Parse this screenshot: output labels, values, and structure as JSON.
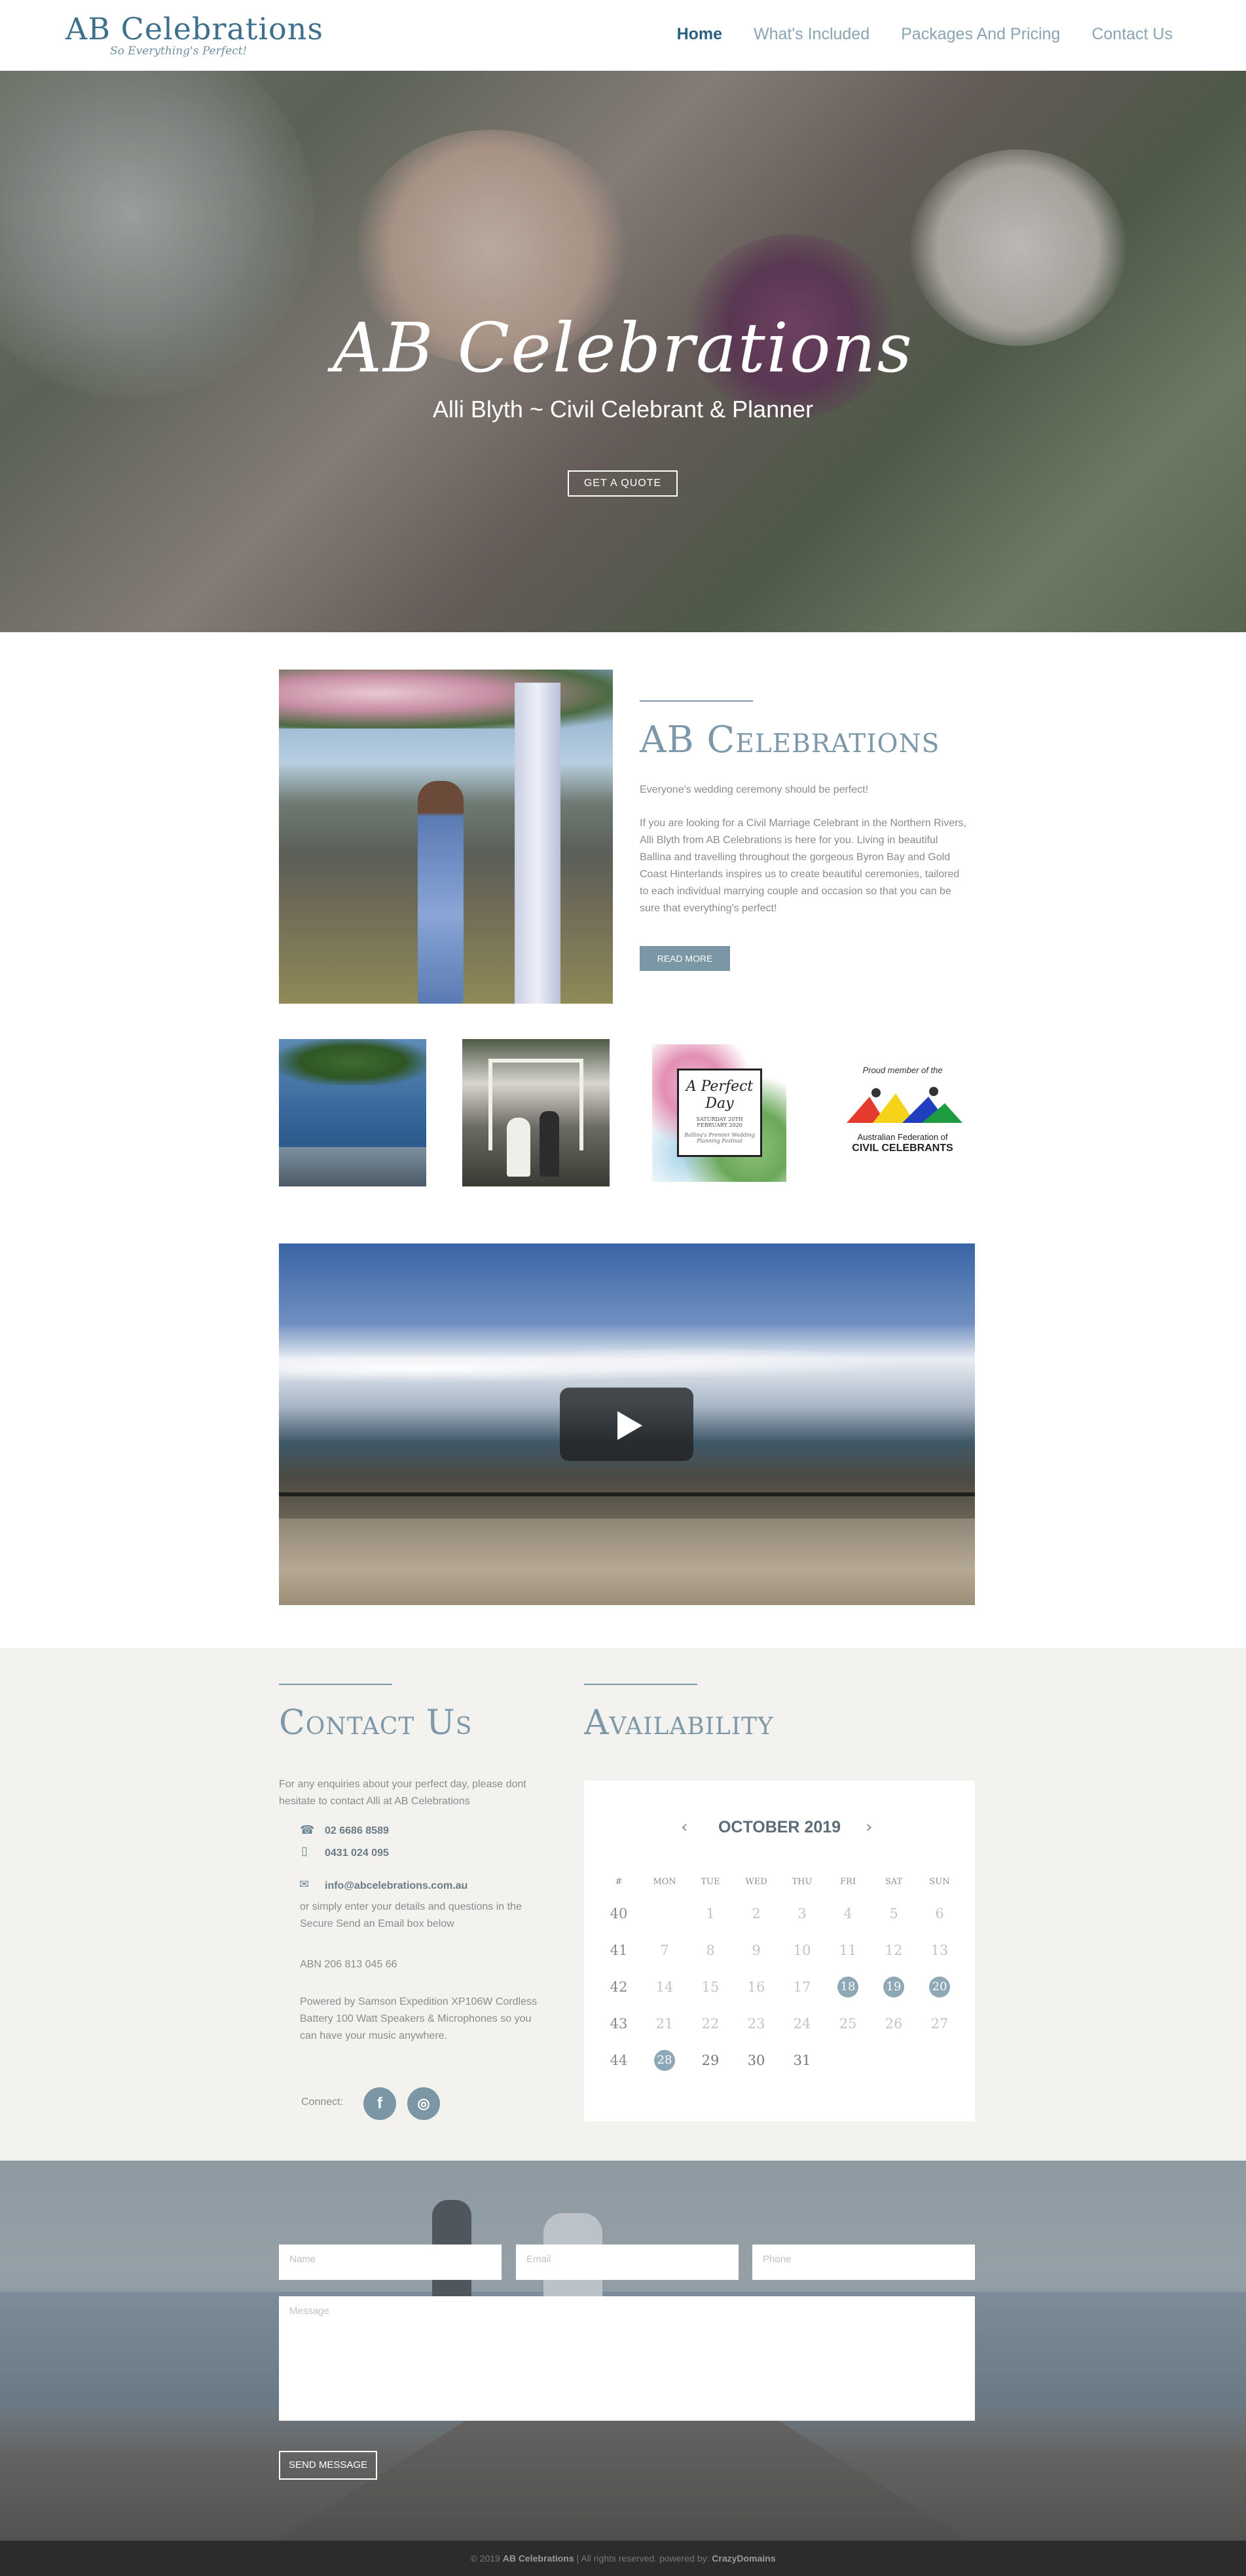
{
  "header": {
    "logo": "AB Celebrations",
    "tagline": "So Everything's Perfect!",
    "nav": [
      {
        "label": "Home",
        "active": true
      },
      {
        "label": "What's Included",
        "active": false
      },
      {
        "label": "Packages And Pricing",
        "active": false
      },
      {
        "label": "Contact Us",
        "active": false
      }
    ]
  },
  "hero": {
    "title": "AB Celebrations",
    "subtitle": "Alli Blyth ~ Civil Celebrant & Planner",
    "button": "GET A QUOTE"
  },
  "about": {
    "title": "AB Celebrations",
    "intro": "Everyone's wedding ceremony should be perfect!",
    "body": "If you are looking for a Civil Marriage Celebrant in the Northern Rivers, Alli Blyth from AB Celebrations is here for you. Living in beautiful Ballina and travelling throughout the gorgeous Byron Bay and Gold Coast Hinterlands inspires us to create beautiful ceremonies, tailored to each individual marrying couple and occasion so that you can be sure that everything's perfect!",
    "button": "READ MORE"
  },
  "badges": {
    "perfect_day": {
      "title": "A Perfect Day",
      "date": "SATURDAY 20TH FEBRUARY 2020",
      "caption": "Ballina's Premier Wedding Planning Festival"
    },
    "afcc": {
      "top": "Proud member of the",
      "line1": "Australian Federation of",
      "line2": "CIVIL CELEBRANTS"
    }
  },
  "contact": {
    "title": "Contact Us",
    "intro": "For any enquiries about your perfect day, please dont hesitate to contact Alli at AB Celebrations",
    "phone": "02 6686 8589",
    "mobile": "0431 024 095",
    "email": "info@abcelebrations.com.au",
    "email_note": "or simply enter your details and questions in the Secure Send an Email box below",
    "abn": "ABN 206 813 045 66",
    "powered": "Powered by Samson Expedition XP106W Cordless Battery 100 Watt Speakers & Microphones so you can have your music anywhere.",
    "connect_label": "Connect:",
    "social": [
      {
        "icon": "facebook-icon",
        "glyph": "f"
      },
      {
        "icon": "instagram-icon",
        "glyph": "◎"
      }
    ]
  },
  "availability": {
    "title": "Availability",
    "month": "OCTOBER 2019",
    "dow": [
      "#",
      "MON",
      "TUE",
      "WED",
      "THU",
      "FRI",
      "SAT",
      "SUN"
    ],
    "weeks": [
      {
        "week": "40",
        "days": [
          "",
          "1",
          "2",
          "3",
          "4",
          "5",
          "6"
        ]
      },
      {
        "week": "41",
        "days": [
          "7",
          "8",
          "9",
          "10",
          "11",
          "12",
          "13"
        ]
      },
      {
        "week": "42",
        "days": [
          "14",
          "15",
          "16",
          "17",
          "18",
          "19",
          "20"
        ]
      },
      {
        "week": "43",
        "days": [
          "21",
          "22",
          "23",
          "24",
          "25",
          "26",
          "27"
        ]
      },
      {
        "week": "44",
        "days": [
          "28",
          "29",
          "30",
          "31",
          "",
          "",
          ""
        ]
      }
    ],
    "booked": [
      "18",
      "19",
      "20",
      "28"
    ],
    "current_from": "29"
  },
  "form": {
    "name_placeholder": "Name",
    "email_placeholder": "Email",
    "phone_placeholder": "Phone",
    "message_placeholder": "Message",
    "send": "SEND MESSAGE"
  },
  "footer": {
    "prefix": "© 2019",
    "brand": "AB Celebrations",
    "middle": "| All rights reserved. powered by:",
    "powered_by": "CrazyDomains"
  },
  "colors": {
    "accent": "#7d98a8",
    "nav_active": "#2d5f80",
    "section_bg": "#f4f2ee",
    "footer_bg": "#2c2c2c"
  }
}
